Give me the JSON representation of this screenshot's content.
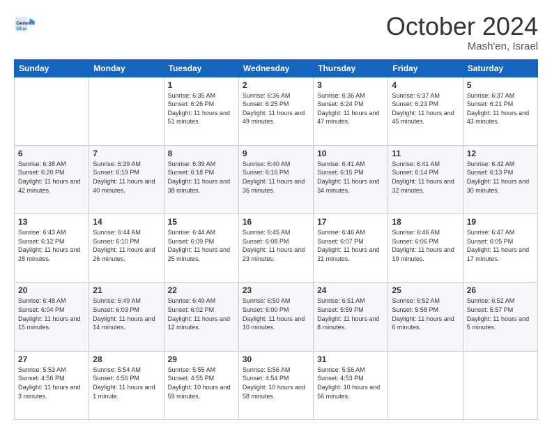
{
  "header": {
    "logo_general": "General",
    "logo_blue": "Blue",
    "month_title": "October 2024",
    "location": "Mash'en, Israel"
  },
  "days_of_week": [
    "Sunday",
    "Monday",
    "Tuesday",
    "Wednesday",
    "Thursday",
    "Friday",
    "Saturday"
  ],
  "weeks": [
    [
      {
        "day": "",
        "info": ""
      },
      {
        "day": "",
        "info": ""
      },
      {
        "day": "1",
        "info": "Sunrise: 6:35 AM\nSunset: 6:26 PM\nDaylight: 11 hours and 51 minutes."
      },
      {
        "day": "2",
        "info": "Sunrise: 6:36 AM\nSunset: 6:25 PM\nDaylight: 11 hours and 49 minutes."
      },
      {
        "day": "3",
        "info": "Sunrise: 6:36 AM\nSunset: 6:24 PM\nDaylight: 11 hours and 47 minutes."
      },
      {
        "day": "4",
        "info": "Sunrise: 6:37 AM\nSunset: 6:23 PM\nDaylight: 11 hours and 45 minutes."
      },
      {
        "day": "5",
        "info": "Sunrise: 6:37 AM\nSunset: 6:21 PM\nDaylight: 11 hours and 43 minutes."
      }
    ],
    [
      {
        "day": "6",
        "info": "Sunrise: 6:38 AM\nSunset: 6:20 PM\nDaylight: 11 hours and 42 minutes."
      },
      {
        "day": "7",
        "info": "Sunrise: 6:39 AM\nSunset: 6:19 PM\nDaylight: 11 hours and 40 minutes."
      },
      {
        "day": "8",
        "info": "Sunrise: 6:39 AM\nSunset: 6:18 PM\nDaylight: 11 hours and 38 minutes."
      },
      {
        "day": "9",
        "info": "Sunrise: 6:40 AM\nSunset: 6:16 PM\nDaylight: 11 hours and 36 minutes."
      },
      {
        "day": "10",
        "info": "Sunrise: 6:41 AM\nSunset: 6:15 PM\nDaylight: 11 hours and 34 minutes."
      },
      {
        "day": "11",
        "info": "Sunrise: 6:41 AM\nSunset: 6:14 PM\nDaylight: 11 hours and 32 minutes."
      },
      {
        "day": "12",
        "info": "Sunrise: 6:42 AM\nSunset: 6:13 PM\nDaylight: 11 hours and 30 minutes."
      }
    ],
    [
      {
        "day": "13",
        "info": "Sunrise: 6:43 AM\nSunset: 6:12 PM\nDaylight: 11 hours and 28 minutes."
      },
      {
        "day": "14",
        "info": "Sunrise: 6:44 AM\nSunset: 6:10 PM\nDaylight: 11 hours and 26 minutes."
      },
      {
        "day": "15",
        "info": "Sunrise: 6:44 AM\nSunset: 6:09 PM\nDaylight: 11 hours and 25 minutes."
      },
      {
        "day": "16",
        "info": "Sunrise: 6:45 AM\nSunset: 6:08 PM\nDaylight: 11 hours and 23 minutes."
      },
      {
        "day": "17",
        "info": "Sunrise: 6:46 AM\nSunset: 6:07 PM\nDaylight: 11 hours and 21 minutes."
      },
      {
        "day": "18",
        "info": "Sunrise: 6:46 AM\nSunset: 6:06 PM\nDaylight: 11 hours and 19 minutes."
      },
      {
        "day": "19",
        "info": "Sunrise: 6:47 AM\nSunset: 6:05 PM\nDaylight: 11 hours and 17 minutes."
      }
    ],
    [
      {
        "day": "20",
        "info": "Sunrise: 6:48 AM\nSunset: 6:04 PM\nDaylight: 11 hours and 15 minutes."
      },
      {
        "day": "21",
        "info": "Sunrise: 6:49 AM\nSunset: 6:03 PM\nDaylight: 11 hours and 14 minutes."
      },
      {
        "day": "22",
        "info": "Sunrise: 6:49 AM\nSunset: 6:02 PM\nDaylight: 11 hours and 12 minutes."
      },
      {
        "day": "23",
        "info": "Sunrise: 6:50 AM\nSunset: 6:00 PM\nDaylight: 11 hours and 10 minutes."
      },
      {
        "day": "24",
        "info": "Sunrise: 6:51 AM\nSunset: 5:59 PM\nDaylight: 11 hours and 8 minutes."
      },
      {
        "day": "25",
        "info": "Sunrise: 6:52 AM\nSunset: 5:58 PM\nDaylight: 11 hours and 6 minutes."
      },
      {
        "day": "26",
        "info": "Sunrise: 6:52 AM\nSunset: 5:57 PM\nDaylight: 11 hours and 5 minutes."
      }
    ],
    [
      {
        "day": "27",
        "info": "Sunrise: 5:53 AM\nSunset: 4:56 PM\nDaylight: 11 hours and 3 minutes."
      },
      {
        "day": "28",
        "info": "Sunrise: 5:54 AM\nSunset: 4:56 PM\nDaylight: 11 hours and 1 minute."
      },
      {
        "day": "29",
        "info": "Sunrise: 5:55 AM\nSunset: 4:55 PM\nDaylight: 10 hours and 59 minutes."
      },
      {
        "day": "30",
        "info": "Sunrise: 5:56 AM\nSunset: 4:54 PM\nDaylight: 10 hours and 58 minutes."
      },
      {
        "day": "31",
        "info": "Sunrise: 5:56 AM\nSunset: 4:53 PM\nDaylight: 10 hours and 56 minutes."
      },
      {
        "day": "",
        "info": ""
      },
      {
        "day": "",
        "info": ""
      }
    ]
  ]
}
